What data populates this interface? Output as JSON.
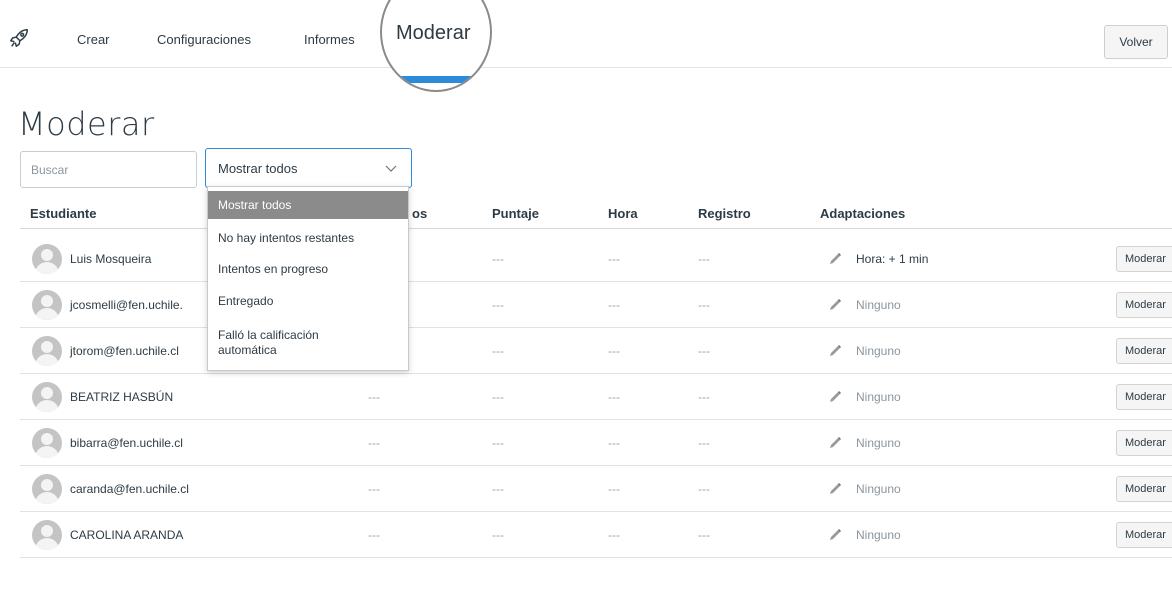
{
  "nav": {
    "logo_icon": "rocket-icon",
    "items": [
      "Crear",
      "Configuraciones",
      "Informes"
    ],
    "active": "Moderar",
    "active_color": "#2b8bd8",
    "back_label": "Volver"
  },
  "page": {
    "title": "Moderar",
    "search_placeholder": "Buscar",
    "filter_value": "Mostrar todos"
  },
  "dropdown": {
    "options": [
      "Mostrar todos",
      "No hay intentos restantes",
      "Intentos en progreso",
      "Entregado",
      "Falló la calificación automática"
    ],
    "selected": "Mostrar todos"
  },
  "table": {
    "columns": [
      "Estudiante",
      "Intentos",
      "Puntaje",
      "Hora",
      "Registro",
      "Adaptaciones"
    ],
    "visible_intentos_header": "os",
    "rows": [
      {
        "name": "Luis Mosqueira",
        "intentos": "",
        "puntaje": "---",
        "hora": "---",
        "registro": "---",
        "adaptaciones": "Hora: + 1 min",
        "action": "Moderar"
      },
      {
        "name": "jcosmelli@fen.uchile.",
        "intentos": "",
        "puntaje": "---",
        "hora": "---",
        "registro": "---",
        "adaptaciones": "Ninguno",
        "action": "Moderar"
      },
      {
        "name": "jtorom@fen.uchile.cl",
        "intentos": "",
        "puntaje": "---",
        "hora": "---",
        "registro": "---",
        "adaptaciones": "Ninguno",
        "action": "Moderar"
      },
      {
        "name": "BEATRIZ HASBÚN",
        "intentos": "---",
        "puntaje": "---",
        "hora": "---",
        "registro": "---",
        "adaptaciones": "Ninguno",
        "action": "Moderar"
      },
      {
        "name": "bibarra@fen.uchile.cl",
        "intentos": "---",
        "puntaje": "---",
        "hora": "---",
        "registro": "---",
        "adaptaciones": "Ninguno",
        "action": "Moderar"
      },
      {
        "name": "caranda@fen.uchile.cl",
        "intentos": "---",
        "puntaje": "---",
        "hora": "---",
        "registro": "---",
        "adaptaciones": "Ninguno",
        "action": "Moderar"
      },
      {
        "name": "CAROLINA ARANDA",
        "intentos": "---",
        "puntaje": "---",
        "hora": "---",
        "registro": "---",
        "adaptaciones": "Ninguno",
        "action": "Moderar"
      }
    ]
  }
}
